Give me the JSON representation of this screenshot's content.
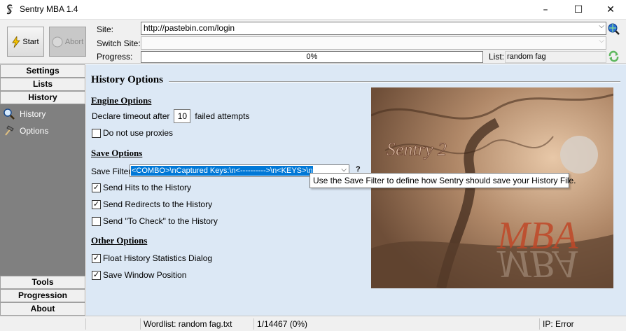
{
  "window": {
    "title": "Sentry MBA 1.4",
    "minimize": "–",
    "maximize": "☐",
    "close": "✕"
  },
  "toolbar": {
    "start_label": "Start",
    "abort_label": "Abort",
    "site_label": "Site:",
    "site_value": "http://pastebin.com/login",
    "switch_site_label": "Switch Site:",
    "switch_site_value": "",
    "progress_label": "Progress:",
    "progress_text": "0%",
    "progress_value": 0,
    "list_label": "List:",
    "list_value": "random fag"
  },
  "sidebar": {
    "settings": "Settings",
    "lists": "Lists",
    "history": "History",
    "history_items": [
      {
        "label": "History"
      },
      {
        "label": "Options"
      }
    ],
    "tools": "Tools",
    "progression": "Progression",
    "about": "About"
  },
  "main": {
    "title": "History Options",
    "engine_options": {
      "heading": "Engine Options",
      "timeout_prefix": "Declare timeout after",
      "timeout_value": "10",
      "timeout_suffix": "failed attempts",
      "no_proxies_label": "Do not use proxies",
      "no_proxies_checked": false
    },
    "save_options": {
      "heading": "Save Options",
      "filter_label": "Save Filter:",
      "filter_value": "<COMBO>\\nCaptured Keys:\\n<---------->\\n<KEYS>\\n",
      "send_hits_label": "Send Hits to the History",
      "send_hits_checked": true,
      "send_redirects_label": "Send Redirects to the History",
      "send_redirects_checked": true,
      "send_tocheck_label": "Send \"To Check\" to the History",
      "send_tocheck_checked": false
    },
    "other_options": {
      "heading": "Other Options",
      "float_stats_label": "Float History Statistics Dialog",
      "float_stats_checked": true,
      "save_pos_label": "Save Window Position",
      "save_pos_checked": true
    },
    "art": {
      "text1": "Sentry 2",
      "text2": "MBA",
      "text3": "MBA"
    },
    "tooltip": "Use the Save Filter to define how Sentry should save your History File."
  },
  "status": {
    "seg0": "",
    "wordlist": "Wordlist: random fag.txt",
    "count": "1/14467 (0%)",
    "ip": "IP: Error"
  },
  "colors": {
    "accent": "#0078d7",
    "sidebar": "#808080",
    "main_bg": "#dce8f5"
  }
}
